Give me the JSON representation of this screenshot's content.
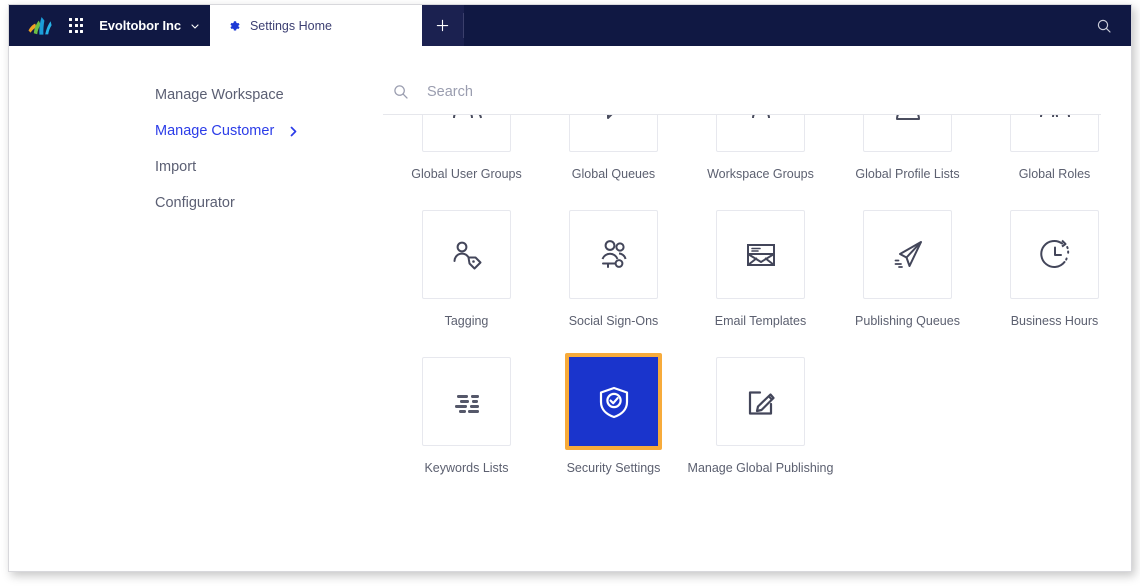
{
  "topbar": {
    "logo_icon": "sprinklr-splash-logo",
    "app_launcher_icon": "grid-apps-icon",
    "brand_name": "Evoltobor Inc",
    "brand_caret_icon": "chevron-down-icon",
    "tab": {
      "icon": "gear-icon",
      "label": "Settings Home"
    },
    "new_tab_icon": "plus-icon",
    "search_icon": "search-icon",
    "background_color": "#101843"
  },
  "sidebar": {
    "items": [
      {
        "label": "Manage Workspace",
        "active": false,
        "chevron": false
      },
      {
        "label": "Manage Customer",
        "active": true,
        "chevron": true
      },
      {
        "label": "Import",
        "active": false,
        "chevron": false
      },
      {
        "label": "Configurator",
        "active": false,
        "chevron": false
      }
    ],
    "active_color": "#2b3ce8"
  },
  "search": {
    "icon": "search-icon",
    "placeholder": "Search",
    "value": ""
  },
  "tiles": [
    {
      "label": "Global User Groups",
      "icon": "user-group-icon",
      "selected": false,
      "clipped_top": true
    },
    {
      "label": "Global Queues",
      "icon": "queue-icon",
      "selected": false,
      "clipped_top": true
    },
    {
      "label": "Workspace Groups",
      "icon": "workspace-group-icon",
      "selected": false,
      "clipped_top": true
    },
    {
      "label": "Global Profile Lists",
      "icon": "profile-list-icon",
      "selected": false,
      "clipped_top": true
    },
    {
      "label": "Global Roles",
      "icon": "roles-icon",
      "selected": false,
      "clipped_top": true
    },
    {
      "label": "Tagging",
      "icon": "person-tag-icon",
      "selected": false,
      "clipped_top": false
    },
    {
      "label": "Social Sign-Ons",
      "icon": "people-key-icon",
      "selected": false,
      "clipped_top": false
    },
    {
      "label": "Email Templates",
      "icon": "email-envelope-icon",
      "selected": false,
      "clipped_top": false
    },
    {
      "label": "Publishing Queues",
      "icon": "paper-plane-icon",
      "selected": false,
      "clipped_top": false
    },
    {
      "label": "Business Hours",
      "icon": "clock-dashed-icon",
      "selected": false,
      "clipped_top": false
    },
    {
      "label": "Keywords Lists",
      "icon": "text-lines-icon",
      "selected": false,
      "clipped_top": false
    },
    {
      "label": "Security Settings",
      "icon": "shield-check-icon",
      "selected": true,
      "clipped_top": false
    },
    {
      "label": "Manage Global Publishing",
      "icon": "edit-square-icon",
      "selected": false,
      "clipped_top": false
    }
  ],
  "colors": {
    "selected_tile_background": "#1a34cc",
    "selected_tile_border": "#f7ab3b",
    "tile_border": "#e7e8ee",
    "label_text": "#5c6070"
  }
}
